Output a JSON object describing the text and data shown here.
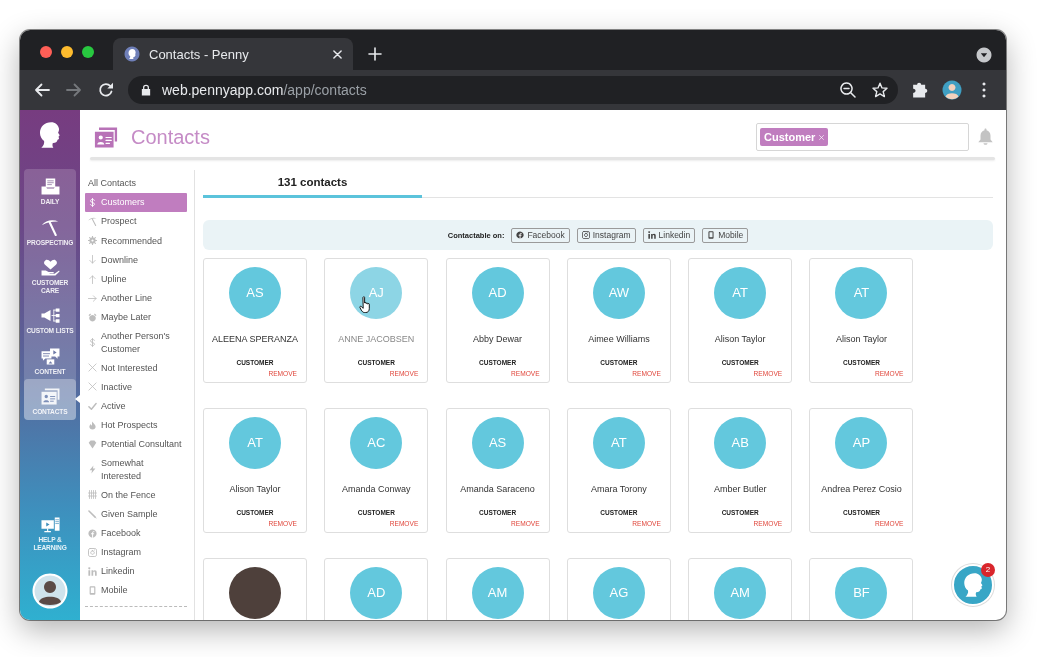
{
  "browser": {
    "tab_title": "Contacts - Penny",
    "url_host": "web.pennyapp.com",
    "url_path": "/app/contacts"
  },
  "nav": {
    "items": [
      {
        "label": "DAILY",
        "selected": false
      },
      {
        "label": "PROSPECTING",
        "selected": false
      },
      {
        "label": "CUSTOMER CARE",
        "selected": false
      },
      {
        "label": "CUSTOM LISTS",
        "selected": false
      },
      {
        "label": "CONTENT",
        "selected": false
      },
      {
        "label": "CONTACTS",
        "selected": true
      }
    ],
    "help_label": "HELP & LEARNING"
  },
  "header": {
    "title": "Contacts",
    "filter_tags": [
      "Customer"
    ]
  },
  "filters": [
    {
      "label": "All Contacts",
      "selected": false
    },
    {
      "label": "Customers",
      "selected": true
    },
    {
      "label": "Prospect",
      "selected": false
    },
    {
      "label": "Recommended",
      "selected": false
    },
    {
      "label": "Downline",
      "selected": false
    },
    {
      "label": "Upline",
      "selected": false
    },
    {
      "label": "Another Line",
      "selected": false
    },
    {
      "label": "Maybe Later",
      "selected": false
    },
    {
      "label": "Another Person's Customer",
      "selected": false
    },
    {
      "label": "Not Interested",
      "selected": false
    },
    {
      "label": "Inactive",
      "selected": false
    },
    {
      "label": "Active",
      "selected": false
    },
    {
      "label": "Hot Prospects",
      "selected": false
    },
    {
      "label": "Potential Consultant",
      "selected": false
    },
    {
      "label": "Somewhat Interested",
      "selected": false
    },
    {
      "label": "On the Fence",
      "selected": false
    },
    {
      "label": "Given Sample",
      "selected": false
    },
    {
      "label": "Facebook",
      "selected": false
    },
    {
      "label": "Instagram",
      "selected": false
    },
    {
      "label": "Linkedin",
      "selected": false
    },
    {
      "label": "Mobile",
      "selected": false
    }
  ],
  "tabs": [
    {
      "label": "131 contacts",
      "selected": true
    }
  ],
  "contactable": {
    "label": "Contactable on:",
    "channels": [
      "Facebook",
      "Instagram",
      "Linkedin",
      "Mobile"
    ]
  },
  "contacts": [
    {
      "kind": "initials",
      "initials": "AS",
      "name": "ALEENA SPERANZA",
      "tag": "CUSTOMER",
      "action": "REMOVE",
      "hovered": false
    },
    {
      "kind": "initials",
      "initials": "AJ",
      "name": "ANNE JACOBSEN",
      "tag": "CUSTOMER",
      "action": "REMOVE",
      "hovered": true
    },
    {
      "kind": "initials",
      "initials": "AD",
      "name": "Abby Dewar",
      "tag": "CUSTOMER",
      "action": "REMOVE",
      "hovered": false
    },
    {
      "kind": "initials",
      "initials": "AW",
      "name": "Aimee Williams",
      "tag": "CUSTOMER",
      "action": "REMOVE",
      "hovered": false
    },
    {
      "kind": "initials",
      "initials": "AT",
      "name": "Alison Taylor",
      "tag": "CUSTOMER",
      "action": "REMOVE",
      "hovered": false
    },
    {
      "kind": "initials",
      "initials": "AT",
      "name": "Alison Taylor",
      "tag": "CUSTOMER",
      "action": "REMOVE",
      "hovered": false
    },
    {
      "kind": "initials",
      "initials": "AT",
      "name": "Alison Taylor",
      "tag": "CUSTOMER",
      "action": "REMOVE",
      "hovered": false
    },
    {
      "kind": "initials",
      "initials": "AC",
      "name": "Amanda Conway",
      "tag": "CUSTOMER",
      "action": "REMOVE",
      "hovered": false
    },
    {
      "kind": "initials",
      "initials": "AS",
      "name": "Amanda Saraceno",
      "tag": "CUSTOMER",
      "action": "REMOVE",
      "hovered": false
    },
    {
      "kind": "initials",
      "initials": "AT",
      "name": "Amara Torony",
      "tag": "CUSTOMER",
      "action": "REMOVE",
      "hovered": false
    },
    {
      "kind": "initials",
      "initials": "AB",
      "name": "Amber Butler",
      "tag": "CUSTOMER",
      "action": "REMOVE",
      "hovered": false
    },
    {
      "kind": "initials",
      "initials": "AP",
      "name": "Andrea Perez Cosio",
      "tag": "CUSTOMER",
      "action": "REMOVE",
      "hovered": false
    },
    {
      "kind": "photo",
      "hovered": false
    },
    {
      "kind": "initials",
      "initials": "AD",
      "hovered": false
    },
    {
      "kind": "initials",
      "initials": "AM",
      "hovered": false
    },
    {
      "kind": "initials",
      "initials": "AG",
      "hovered": false
    },
    {
      "kind": "initials",
      "initials": "AM",
      "hovered": false
    },
    {
      "kind": "initials",
      "initials": "BF",
      "hovered": false
    }
  ],
  "chat": {
    "badge": "2"
  }
}
